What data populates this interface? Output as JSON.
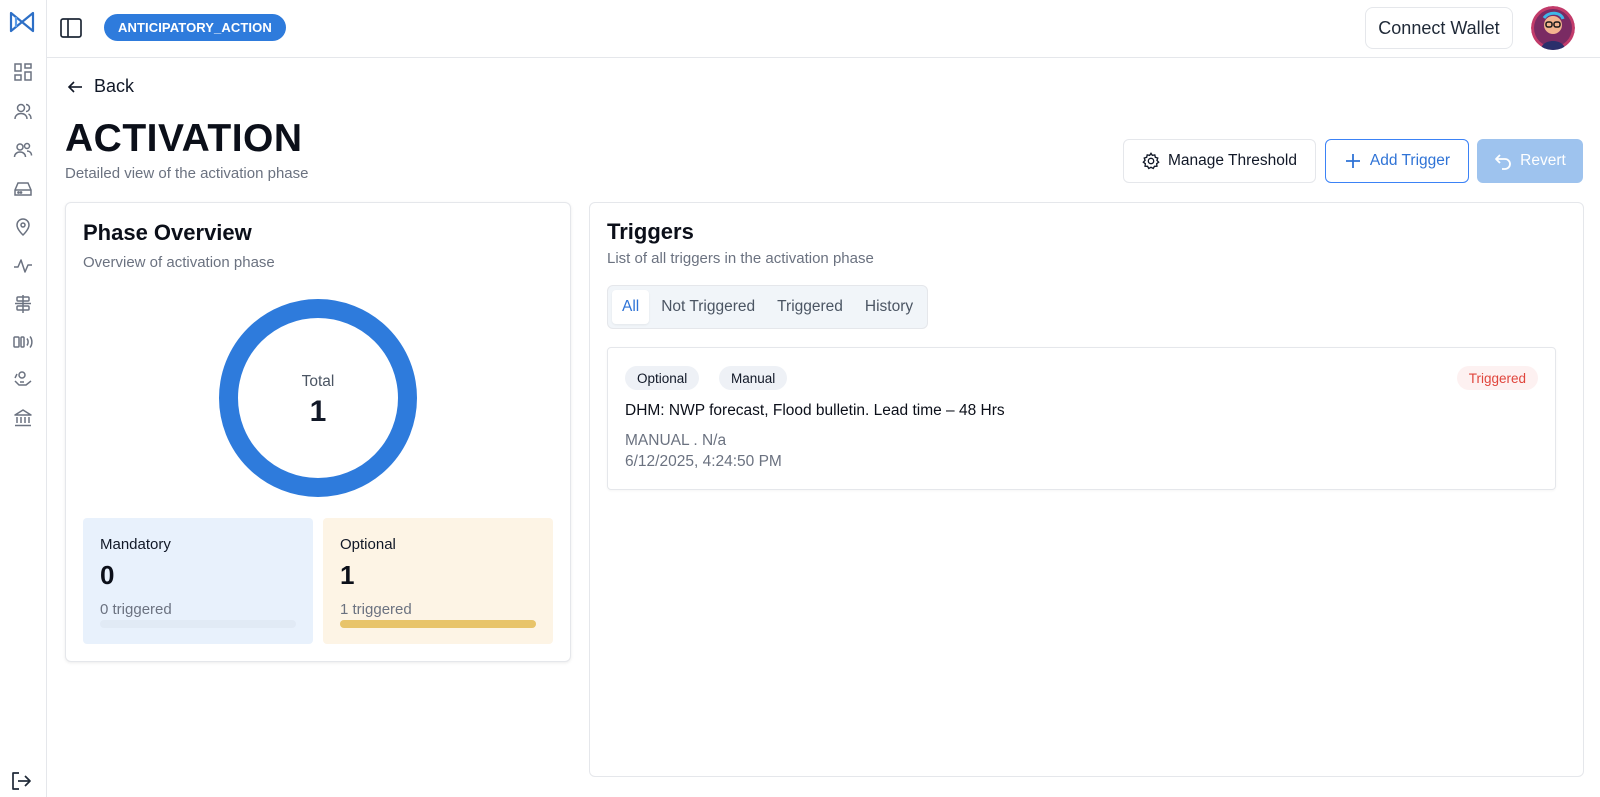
{
  "header": {
    "project_badge": "ANTICIPATORY_ACTION",
    "connect_wallet_label": "Connect Wallet"
  },
  "sidebar": {
    "items": [
      {
        "icon": "dashboard-icon"
      },
      {
        "icon": "beneficiary-icon"
      },
      {
        "icon": "users-icon"
      },
      {
        "icon": "inbox-icon"
      },
      {
        "icon": "location-icon"
      },
      {
        "icon": "activity-icon"
      },
      {
        "icon": "align-center-icon"
      },
      {
        "icon": "broadcast-icon"
      },
      {
        "icon": "helping-hand-icon"
      },
      {
        "icon": "bank-icon"
      }
    ],
    "logout_icon": "logout-icon"
  },
  "page": {
    "back_label": "Back",
    "title": "ACTIVATION",
    "subtitle": "Detailed view of the activation phase",
    "actions": {
      "manage_threshold": "Manage Threshold",
      "add_trigger": "Add Trigger",
      "revert": "Revert"
    }
  },
  "phase_overview": {
    "title": "Phase Overview",
    "subtitle": "Overview of activation phase",
    "total_label": "Total",
    "total_value": "1",
    "mandatory": {
      "label": "Mandatory",
      "value": "0",
      "triggered_text": "0 triggered",
      "progress": 0
    },
    "optional": {
      "label": "Optional",
      "value": "1",
      "triggered_text": "1 triggered",
      "progress": 1
    }
  },
  "triggers": {
    "title": "Triggers",
    "subtitle": "List of all triggers in the activation phase",
    "tabs": [
      "All",
      "Not Triggered",
      "Triggered",
      "History"
    ],
    "active_tab": "All",
    "items": [
      {
        "tags": [
          "Optional",
          "Manual"
        ],
        "status": "Triggered",
        "title": "DHM: NWP forecast, Flood bulletin. Lead time – 48 Hrs",
        "meta": "MANUAL . N/a",
        "date": "6/12/2025, 4:24:50 PM"
      }
    ]
  },
  "colors": {
    "accent": "#2e7bdc",
    "donut": "#2e7bdc",
    "mandatory_bg": "#e8f1fc",
    "optional_bg": "#fdf4e5",
    "optional_bar": "#e8c46a",
    "triggered_text": "#e0453c"
  }
}
